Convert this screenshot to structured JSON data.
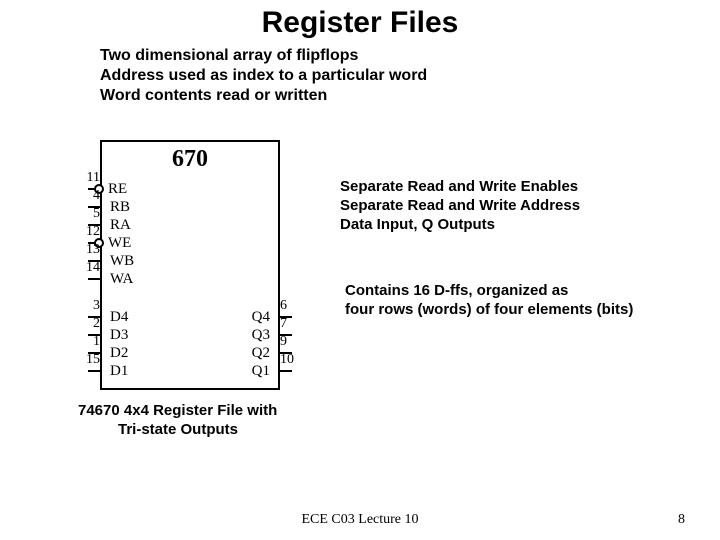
{
  "title": "Register Files",
  "bullets": [
    "Two dimensional array of flipflops",
    "Address used as index to a particular word",
    "Word contents read or written"
  ],
  "chip": {
    "label": "670",
    "left_pins": [
      {
        "num": "11",
        "name": "RE",
        "bubble": true
      },
      {
        "num": "4",
        "name": "RB",
        "bubble": false
      },
      {
        "num": "5",
        "name": "RA",
        "bubble": false
      },
      {
        "num": "12",
        "name": "WE",
        "bubble": true
      },
      {
        "num": "13",
        "name": "WB",
        "bubble": false
      },
      {
        "num": "14",
        "name": "WA",
        "bubble": false
      },
      {
        "num": "3",
        "name": "D4",
        "bubble": false
      },
      {
        "num": "2",
        "name": "D3",
        "bubble": false
      },
      {
        "num": "1",
        "name": "D2",
        "bubble": false
      },
      {
        "num": "15",
        "name": "D1",
        "bubble": false
      }
    ],
    "right_pins": [
      {
        "num": "6",
        "name": "Q4"
      },
      {
        "num": "7",
        "name": "Q3"
      },
      {
        "num": "9",
        "name": "Q2"
      },
      {
        "num": "10",
        "name": "Q1"
      }
    ]
  },
  "side1": [
    "Separate Read and Write Enables",
    "Separate Read and Write Address",
    "Data Input, Q Outputs"
  ],
  "side2": [
    "Contains 16 D-ffs, organized as",
    "four rows (words) of four elements (bits)"
  ],
  "caption": [
    "74670 4x4 Register File with",
    "Tri-state Outputs"
  ],
  "footer_center": "ECE C03 Lecture 10",
  "footer_right": "8"
}
